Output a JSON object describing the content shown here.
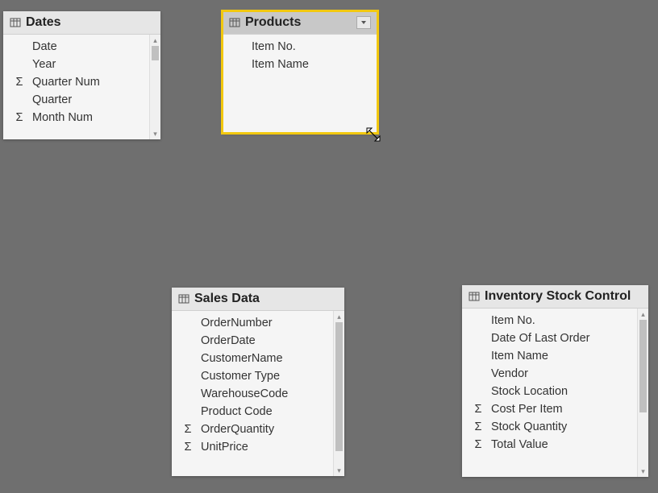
{
  "tables": {
    "dates": {
      "title": "Dates",
      "fields": [
        {
          "label": "Date",
          "measure": false
        },
        {
          "label": "Year",
          "measure": false
        },
        {
          "label": "Quarter Num",
          "measure": true
        },
        {
          "label": "Quarter",
          "measure": false
        },
        {
          "label": "Month Num",
          "measure": true
        }
      ]
    },
    "products": {
      "title": "Products",
      "fields": [
        {
          "label": "Item No.",
          "measure": false
        },
        {
          "label": "Item Name",
          "measure": false
        }
      ]
    },
    "sales": {
      "title": "Sales Data",
      "fields": [
        {
          "label": "OrderNumber",
          "measure": false
        },
        {
          "label": "OrderDate",
          "measure": false
        },
        {
          "label": "CustomerName",
          "measure": false
        },
        {
          "label": "Customer Type",
          "measure": false
        },
        {
          "label": "WarehouseCode",
          "measure": false
        },
        {
          "label": "Product Code",
          "measure": false
        },
        {
          "label": "OrderQuantity",
          "measure": true
        },
        {
          "label": "UnitPrice",
          "measure": true
        }
      ]
    },
    "inventory": {
      "title": "Inventory Stock Control",
      "fields": [
        {
          "label": "Item No.",
          "measure": false
        },
        {
          "label": "Date Of Last Order",
          "measure": false
        },
        {
          "label": "Item Name",
          "measure": false
        },
        {
          "label": "Vendor",
          "measure": false
        },
        {
          "label": "Stock Location",
          "measure": false
        },
        {
          "label": "Cost Per Item",
          "measure": true
        },
        {
          "label": "Stock Quantity",
          "measure": true
        },
        {
          "label": "Total Value",
          "measure": true
        }
      ]
    }
  }
}
